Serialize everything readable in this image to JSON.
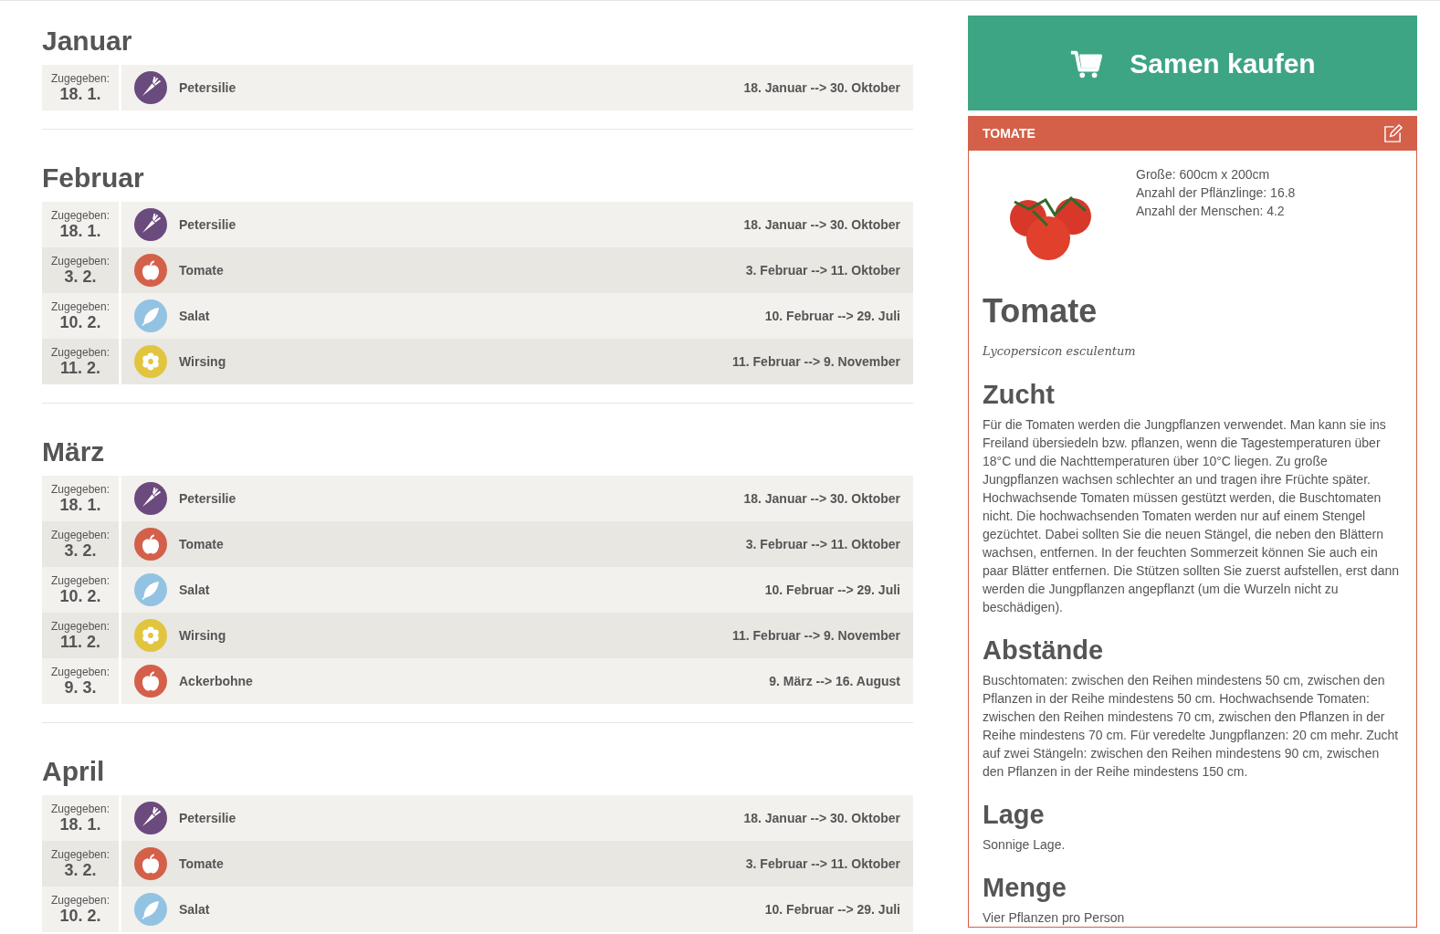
{
  "months": [
    {
      "title": "Januar",
      "entries": [
        {
          "label": "Zugegeben:",
          "date": "18. 1.",
          "name": "Petersilie",
          "range": "18. Januar --> 30. Oktober",
          "kind": "carrot",
          "color": "#6b4a7e"
        }
      ]
    },
    {
      "title": "Februar",
      "entries": [
        {
          "label": "Zugegeben:",
          "date": "18. 1.",
          "name": "Petersilie",
          "range": "18. Januar --> 30. Oktober",
          "kind": "carrot",
          "color": "#6b4a7e"
        },
        {
          "label": "Zugegeben:",
          "date": "3. 2.",
          "name": "Tomate",
          "range": "3. Februar --> 11. Oktober",
          "kind": "apple",
          "color": "#d4604a"
        },
        {
          "label": "Zugegeben:",
          "date": "10. 2.",
          "name": "Salat",
          "range": "10. Februar --> 29. Juli",
          "kind": "leaf",
          "color": "#93c3e3"
        },
        {
          "label": "Zugegeben:",
          "date": "11. 2.",
          "name": "Wirsing",
          "range": "11. Februar --> 9. November",
          "kind": "flower",
          "color": "#e2c53f"
        }
      ]
    },
    {
      "title": "März",
      "entries": [
        {
          "label": "Zugegeben:",
          "date": "18. 1.",
          "name": "Petersilie",
          "range": "18. Januar --> 30. Oktober",
          "kind": "carrot",
          "color": "#6b4a7e"
        },
        {
          "label": "Zugegeben:",
          "date": "3. 2.",
          "name": "Tomate",
          "range": "3. Februar --> 11. Oktober",
          "kind": "apple",
          "color": "#d4604a"
        },
        {
          "label": "Zugegeben:",
          "date": "10. 2.",
          "name": "Salat",
          "range": "10. Februar --> 29. Juli",
          "kind": "leaf",
          "color": "#93c3e3"
        },
        {
          "label": "Zugegeben:",
          "date": "11. 2.",
          "name": "Wirsing",
          "range": "11. Februar --> 9. November",
          "kind": "flower",
          "color": "#e2c53f"
        },
        {
          "label": "Zugegeben:",
          "date": "9. 3.",
          "name": "Ackerbohne",
          "range": "9. März --> 16. August",
          "kind": "apple",
          "color": "#d4604a"
        }
      ]
    },
    {
      "title": "April",
      "entries": [
        {
          "label": "Zugegeben:",
          "date": "18. 1.",
          "name": "Petersilie",
          "range": "18. Januar --> 30. Oktober",
          "kind": "carrot",
          "color": "#6b4a7e"
        },
        {
          "label": "Zugegeben:",
          "date": "3. 2.",
          "name": "Tomate",
          "range": "3. Februar --> 11. Oktober",
          "kind": "apple",
          "color": "#d4604a"
        },
        {
          "label": "Zugegeben:",
          "date": "10. 2.",
          "name": "Salat",
          "range": "10. Februar --> 29. Juli",
          "kind": "leaf",
          "color": "#93c3e3"
        }
      ]
    }
  ],
  "buy_button": "Samen kaufen",
  "detail": {
    "header": "TOMATE",
    "facts": [
      "Große: 600cm x 200cm",
      "Anzahl der Pflänzlinge: 16.8",
      "Anzahl der Menschen: 4.2"
    ],
    "title": "Tomate",
    "latin": "Lycopersicon esculentum",
    "sections": [
      {
        "heading": "Zucht",
        "text": "Für die Tomaten werden die Jungpflanzen verwendet. Man kann sie ins Freiland übersiedeln bzw. pflanzen, wenn die Tagestemperaturen über 18°C und die Nachttemperaturen über 10°C liegen. Zu große Jungpflanzen wachsen schlechter an und tragen ihre Früchte später. Hochwachsende Tomaten müssen gestützt werden, die Buschtomaten nicht. Die hochwachsenden Tomaten werden nur auf einem Stengel gezüchtet. Dabei sollten Sie die neuen Stängel, die neben den Blättern wachsen, entfernen. In der feuchten Sommerzeit können Sie auch ein paar Blätter entfernen. Die Stützen sollten Sie zuerst aufstellen, erst dann werden die Jungpflanzen angepflanzt (um die Wurzeln nicht zu beschädigen)."
      },
      {
        "heading": "Abstände",
        "text": "Buschtomaten: zwischen den Reihen mindestens 50 cm, zwischen den Pflanzen in der Reihe mindestens 50 cm. Hochwachsende Tomaten: zwischen den Reihen mindestens 70 cm, zwischen den Pflanzen in der Reihe mindestens 70 cm. Für veredelte Jungpflanzen: 20 cm mehr. Zucht auf zwei Stängeln: zwischen den Reihen mindestens 90 cm, zwischen den Pflanzen in der Reihe mindestens 150 cm."
      },
      {
        "heading": "Lage",
        "text": "Sonnige Lage."
      },
      {
        "heading": "Menge",
        "text": "Vier Pflanzen pro Person"
      }
    ]
  }
}
